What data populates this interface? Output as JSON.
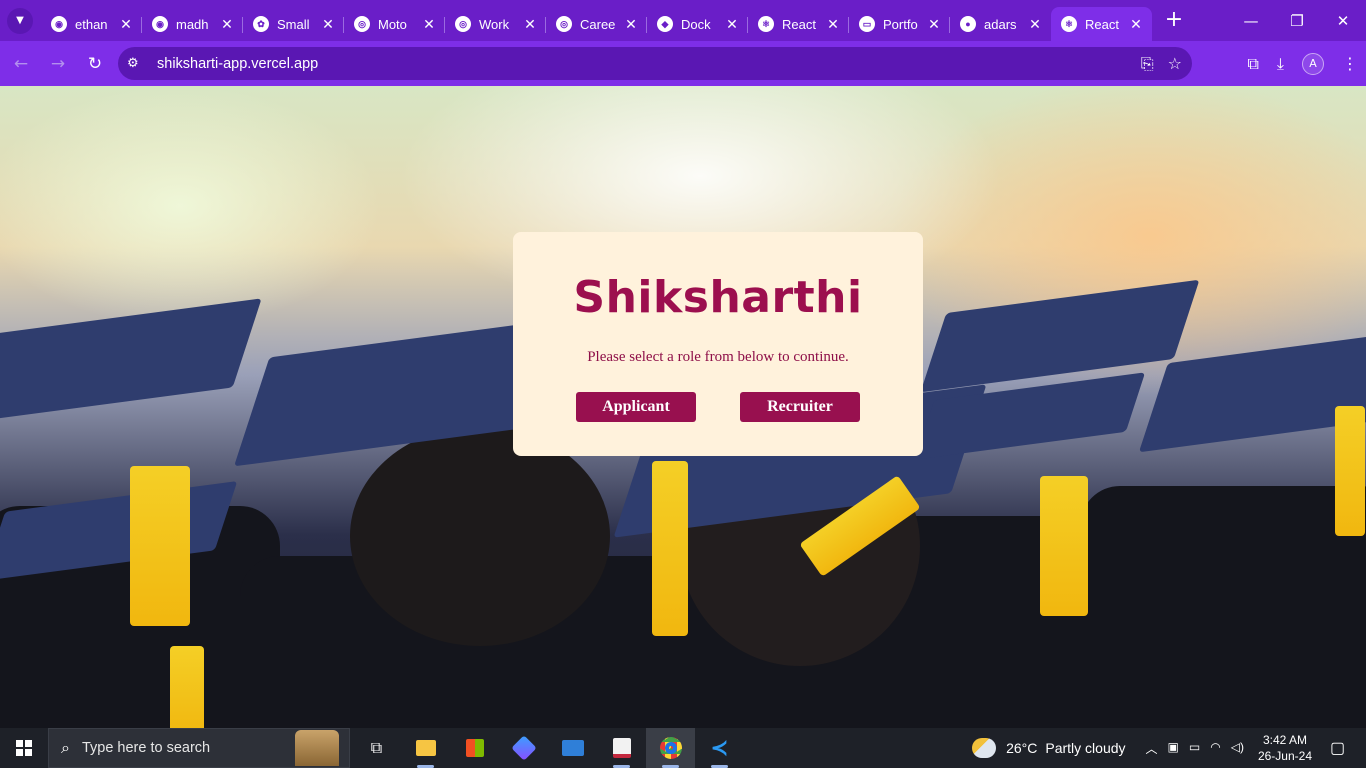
{
  "browser": {
    "tabs": [
      {
        "label": "ethan",
        "icon": "crypto-icon"
      },
      {
        "label": "madh",
        "icon": "crypto-icon"
      },
      {
        "label": "Small",
        "icon": "chatgpt-icon"
      },
      {
        "label": "Moto",
        "icon": "globe-icon"
      },
      {
        "label": "Work",
        "icon": "globe-icon"
      },
      {
        "label": "Caree",
        "icon": "globe-icon"
      },
      {
        "label": "Dock",
        "icon": "figma-icon"
      },
      {
        "label": "React",
        "icon": "react-icon"
      },
      {
        "label": "Portfo",
        "icon": "monitor-icon"
      },
      {
        "label": "adars",
        "icon": "github-icon"
      },
      {
        "label": "React",
        "icon": "react-icon",
        "active": true
      }
    ],
    "url": "shiksharti-app.vercel.app",
    "profile_initial": "A"
  },
  "dialog": {
    "title": "Shiksharthi",
    "message": "Please select a role from below to continue.",
    "buttons": {
      "applicant": "Applicant",
      "recruiter": "Recruiter"
    }
  },
  "taskbar": {
    "search_placeholder": "Type here to search",
    "weather_temp": "26°C",
    "weather_desc": "Partly cloudy",
    "time": "3:42 AM",
    "date": "26-Jun-24"
  },
  "colors": {
    "browser_frame": "#6a1ec8",
    "dialog_bg": "#fff2dc",
    "brand": "#9c0f4e"
  }
}
